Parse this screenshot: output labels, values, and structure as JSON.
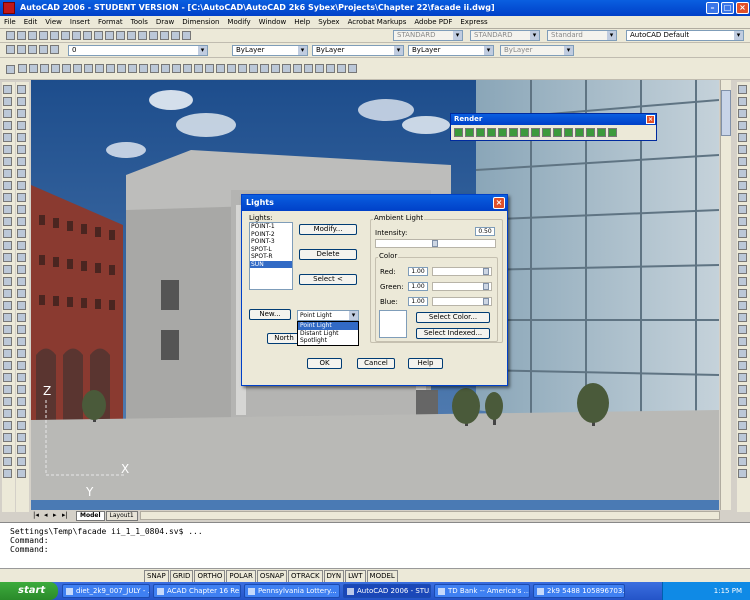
{
  "window": {
    "title": "AutoCAD 2006 - STUDENT VERSION - [C:\\AutoCAD\\AutoCAD 2k6 Sybex\\Projects\\Chapter 22\\facade ii.dwg]"
  },
  "menu": [
    "File",
    "Edit",
    "View",
    "Insert",
    "Format",
    "Tools",
    "Draw",
    "Dimension",
    "Modify",
    "Window",
    "Help",
    "Sybex",
    "Acrobat Markups",
    "Adobe PDF",
    "Express"
  ],
  "toolbars": {
    "layer_value": "0",
    "textstyle": "STANDARD",
    "dimstyle": "STANDARD",
    "tablestyle": "Standard",
    "workspace": "AutoCAD Default",
    "color": "ByLayer",
    "linetype": "ByLayer",
    "lineweight": "ByLayer",
    "plotstyle": "ByLayer"
  },
  "render_toolbar": {
    "title": "Render"
  },
  "lights_dialog": {
    "title": "Lights",
    "lights_label": "Lights:",
    "lights": [
      "POINT-1",
      "POINT-2",
      "POINT-3",
      "SPOT-L",
      "SPOT-R",
      "SUN"
    ],
    "selected_light": "SUN",
    "modify": "Modify...",
    "delete": "Delete",
    "select": "Select <",
    "new": "New...",
    "north": "North",
    "type_selected": "Point Light",
    "type_options": [
      "Point Light",
      "Distant Light",
      "Spotlight"
    ],
    "ambient_label": "Ambient Light",
    "intensity_label": "Intensity:",
    "intensity": "0.50",
    "color_label": "Color",
    "red_label": "Red:",
    "red": "1.00",
    "green_label": "Green:",
    "green": "1.00",
    "blue_label": "Blue:",
    "blue": "1.00",
    "select_color": "Select Color...",
    "select_indexed": "Select Indexed...",
    "ok": "OK",
    "cancel": "Cancel",
    "help": "Help"
  },
  "layout_tabs": [
    "Model",
    "Layout1"
  ],
  "ucs": {
    "y": "Y",
    "x": "X",
    "z": "Z"
  },
  "command_lines": [
    "Settings\\Temp\\facade ii_1_1_0804.sv$ ...",
    "Command:",
    "Command:"
  ],
  "status_buttons": [
    "SNAP",
    "GRID",
    "ORTHO",
    "POLAR",
    "OSNAP",
    "OTRACK",
    "DYN",
    "LWT",
    "MODEL"
  ],
  "taskbar": {
    "start": "start",
    "tasks": [
      "diet_2k9_007_JULY - ...",
      "ACAD Chapter 16 Re...",
      "Pennsylvania Lottery...",
      "AutoCAD 2006 - STU...",
      "TD Bank -- America's ...",
      "2k9 5488 105896703..."
    ],
    "active_task": 3,
    "clock": "1:15 PM"
  }
}
